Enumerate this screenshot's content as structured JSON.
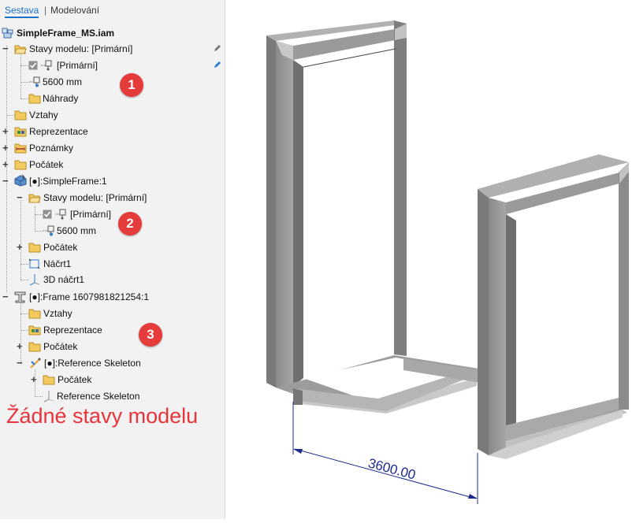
{
  "tabs": {
    "assembly": "Sestava",
    "modeling": "Modelování"
  },
  "tree": {
    "root": "SimpleFrame_MS.iam",
    "r1": "Stavy modelu: [Primární]",
    "r2": "[Primární]",
    "r3": "5600 mm",
    "r4": "Náhrady",
    "r5": "Vztahy",
    "r6": "Reprezentace",
    "r7": "Poznámky",
    "r8": "Počátek",
    "r9": "[●]:SimpleFrame:1",
    "r10": "Stavy modelu: [Primární]",
    "r11": "[Primární]",
    "r12": "5600 mm",
    "r13": "Počátek",
    "r14": "Náčrt1",
    "r15": "3D náčrt1",
    "r16": "[●]:Frame 1607981821254:1",
    "r17": "Vztahy",
    "r18": "Reprezentace",
    "r19": "Počátek",
    "r20": "[●]:Reference Skeleton",
    "r21": "Počátek",
    "r22": "Reference Skeleton"
  },
  "badges": {
    "b1": "1",
    "b2": "2",
    "b3": "3"
  },
  "note": "Žádné stavy modelu",
  "dimension": "3600.00",
  "colors": {
    "accent": "#1a73c7",
    "badge": "#e53b3b",
    "note": "#e8343a"
  }
}
